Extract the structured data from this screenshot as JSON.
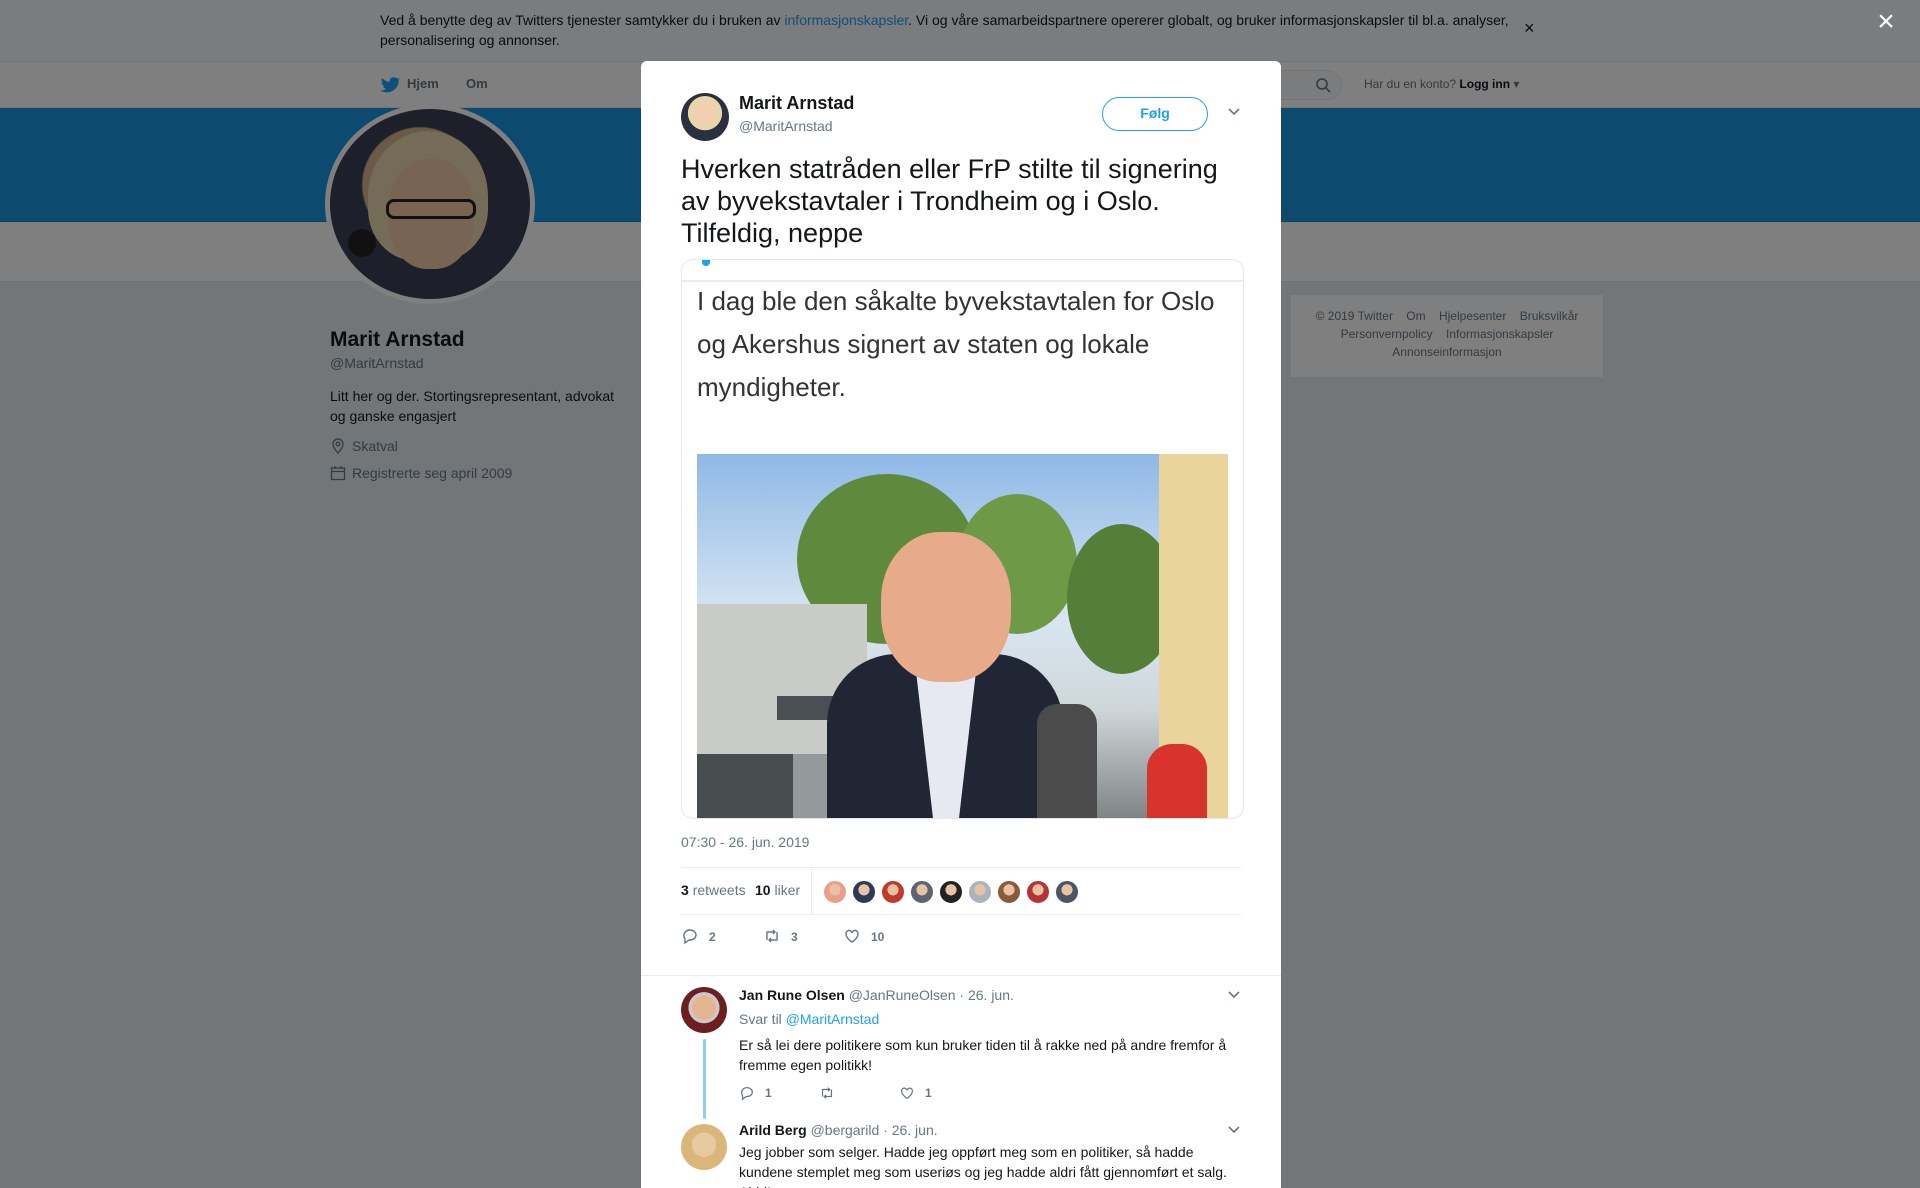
{
  "cookie": {
    "text_before": "Ved å benytte deg av Twitters tjenester samtykker du i bruken av ",
    "link": "informasjonskapsler",
    "text_after": ". Vi og våre samarbeidspartnere opererer globalt, og bruker informasjonskapsler til bl.a. analyser, personalisering og annonser.",
    "close": "×"
  },
  "nav": {
    "home": "Hjem",
    "about": "Om",
    "login_prompt": "Har du en konto?",
    "login": "Logg inn"
  },
  "profile": {
    "name": "Marit Arnstad",
    "handle": "@MaritArnstad",
    "bio": "Litt her og der. Stortingsrepresentant, advokat og ganske engasjert",
    "location": "Skatval",
    "joined": "Registrerte seg april 2009"
  },
  "footer": {
    "links_row1": [
      "© 2019 Twitter",
      "Om",
      "Hjelpesenter",
      "Bruksvilkår"
    ],
    "links_row2": [
      "Personvernpolicy",
      "Informasjonskapsler"
    ],
    "links_row3": [
      "Annonseinformasjon"
    ]
  },
  "overlay": {
    "close": "×"
  },
  "tweet": {
    "name": "Marit Arnstad",
    "handle": "@MaritArnstad",
    "follow": "Følg",
    "text": "Hverken statråden eller FrP stilte til signering av byvekstavtaler i Trondheim og i Oslo. Tilfeldig, neppe",
    "media_caption": "I dag ble den såkalte byvekstavtalen for Oslo og Akershus signert av staten og lokale myndigheter.",
    "time": "07:30 - 26. jun. 2019",
    "retweets_count": "3",
    "retweets_label": "retweets",
    "likes_count": "10",
    "likes_label": "liker",
    "reply_count": "2",
    "retweet_count_action": "3",
    "like_count_action": "10",
    "liker_colors": [
      "#e8a08c",
      "#2b3a55",
      "#c0392b",
      "#5a6472",
      "#222222",
      "#aab4bf",
      "#8a5a3b",
      "#b8323c",
      "#4b5563"
    ]
  },
  "replies": [
    {
      "name": "Jan Rune Olsen",
      "handle": "@JanRuneOlsen",
      "date": "· 26. jun.",
      "reply_to_label": "Svar til",
      "reply_to": "@MaritArnstad",
      "text": "Er så lei dere politikere som kun bruker tiden til å rakke ned på andre fremfor å fremme egen politikk!",
      "replies": "1",
      "retweets": "",
      "likes": "1"
    },
    {
      "name": "Arild Berg",
      "handle": "@bergarild",
      "date": "· 26. jun.",
      "text": "Jeg jobber som selger. Hadde jeg oppført meg som en politiker, så hadde kundene stemplet meg som useriøs og jeg hadde aldri fått gjennomført et salg. Aldri!"
    }
  ]
}
